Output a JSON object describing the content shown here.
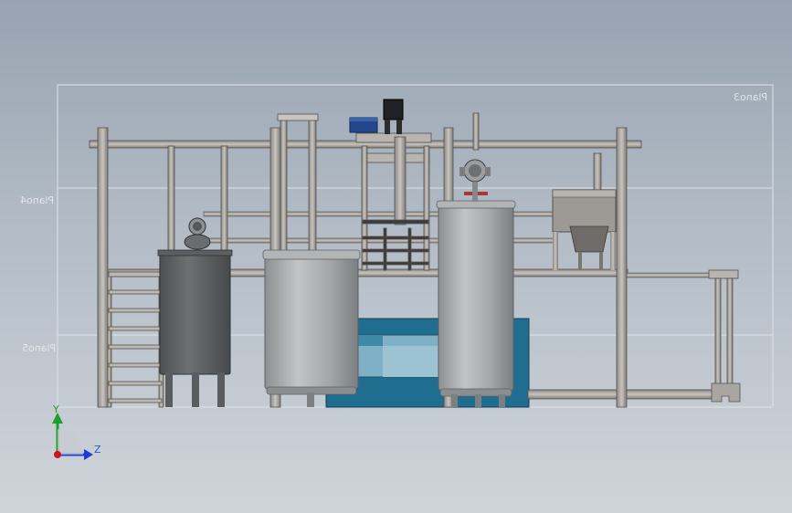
{
  "planes": [
    {
      "id": "plano3",
      "label": "Plano3"
    },
    {
      "id": "plano4",
      "label": "Plano4"
    },
    {
      "id": "plano5",
      "label": "Plano5"
    }
  ],
  "triad": {
    "y_label": "Y",
    "z_label": "Z",
    "y_color": "#1e9e2c",
    "z_color": "#1d3fd1",
    "origin_color": "#c8141b"
  },
  "colors": {
    "frame_steel": "#a9a6a2",
    "frame_edge": "#55514d",
    "tank_dark": "#5e6264",
    "tank_light": "#a6a8aa",
    "base_blue": "#1f6d8f",
    "motor_blue": "#24468a",
    "motor_black": "#1f2124"
  }
}
